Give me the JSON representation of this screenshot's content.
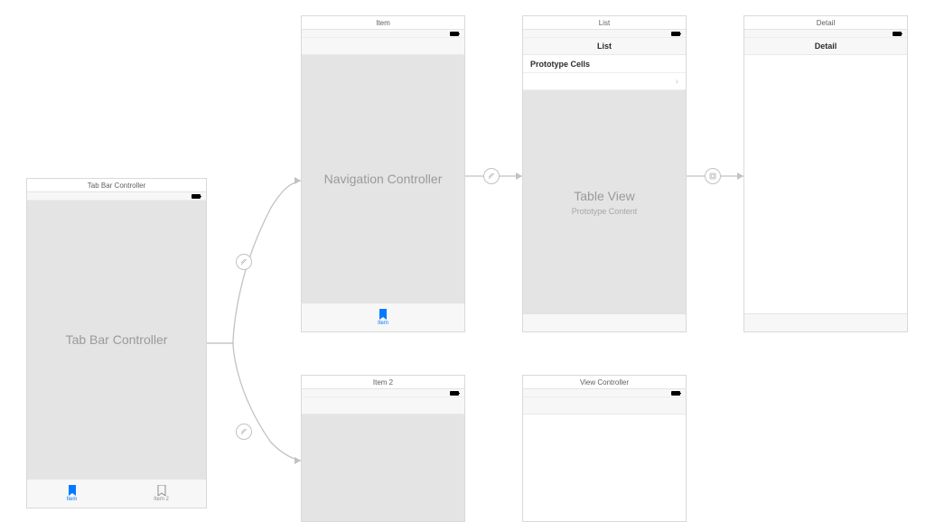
{
  "scenes": {
    "tabbar": {
      "title": "Tab Bar Controller",
      "placeholder": "Tab Bar Controller",
      "tabs": [
        {
          "label": "Item",
          "active": true
        },
        {
          "label": "Item 2",
          "active": false
        }
      ]
    },
    "item": {
      "title": "Item",
      "placeholder": "Navigation Controller",
      "tab_label": "Item"
    },
    "list": {
      "title": "List",
      "nav_title": "List",
      "section_header": "Prototype Cells",
      "table_placeholder_title": "Table View",
      "table_placeholder_sub": "Prototype Content"
    },
    "detail": {
      "title": "Detail",
      "nav_title": "Detail"
    },
    "item2": {
      "title": "Item 2"
    },
    "viewcontroller": {
      "title": "View Controller"
    }
  },
  "segue_icons": {
    "relationship": "⟋",
    "push": "⟋",
    "show": "▢"
  }
}
